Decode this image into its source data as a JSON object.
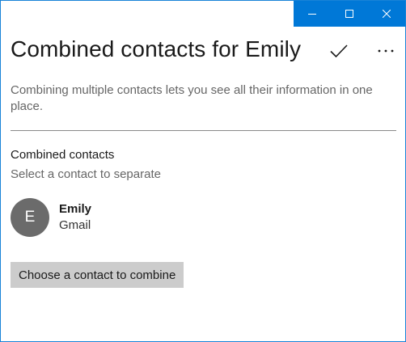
{
  "window": {
    "caption_buttons": [
      "minimize-icon",
      "maximize-icon",
      "close-icon"
    ],
    "accent_color": "#0078d7"
  },
  "header": {
    "title": "Combined contacts for Emily",
    "actions": [
      "checkmark-icon",
      "more-icon"
    ]
  },
  "description": "Combining multiple contacts lets you see all their information in one place.",
  "combined": {
    "heading": "Combined contacts",
    "subheading": "Select a contact to separate",
    "contacts": [
      {
        "initial": "E",
        "name": "Emily",
        "source": "Gmail"
      }
    ]
  },
  "combine_button_label": "Choose a contact to combine"
}
